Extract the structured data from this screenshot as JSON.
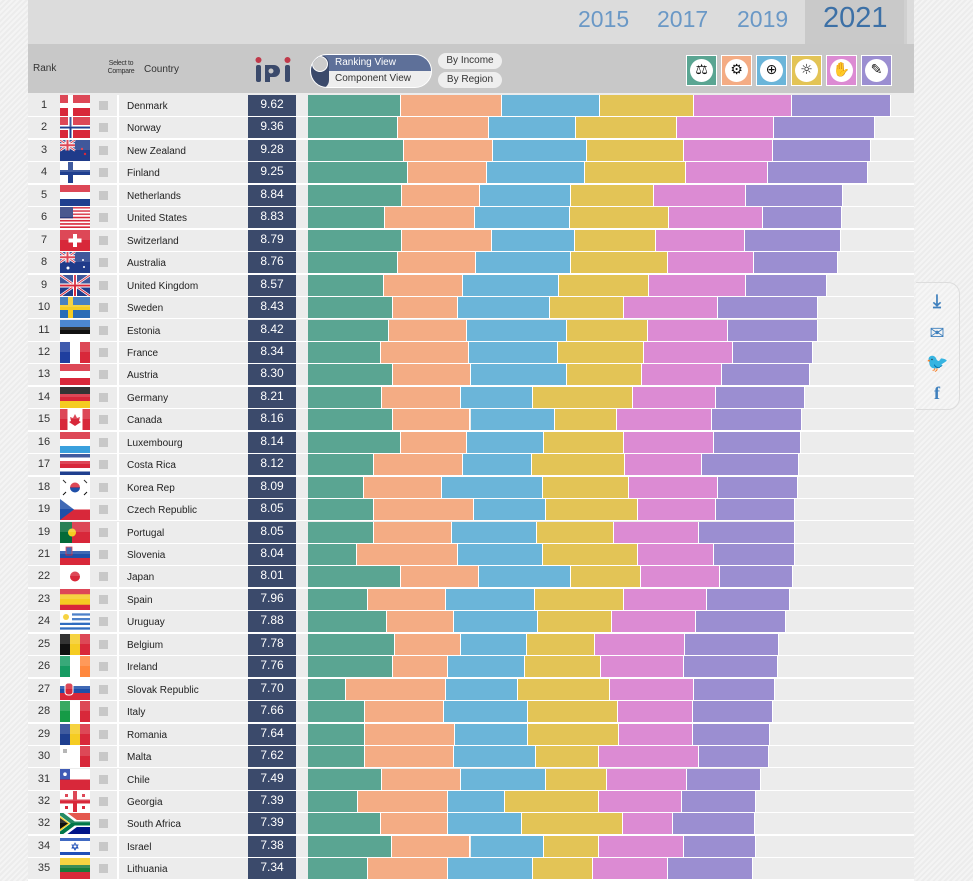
{
  "years": [
    "2015",
    "2017",
    "2019",
    "2021"
  ],
  "selected_year": "2021",
  "header": {
    "rank": "Rank",
    "select": "Select to Compare",
    "country": "Country",
    "logo": "iPi",
    "ranking_view": "Ranking View",
    "component_view": "Component View",
    "by_income": "By Income",
    "by_region": "By Region"
  },
  "component_icons": [
    {
      "icon": "gavel-icon",
      "color": "#5aa592"
    },
    {
      "icon": "document-gear-icon",
      "color": "#f4ac84"
    },
    {
      "icon": "globe-icon",
      "color": "#6bb5d9"
    },
    {
      "icon": "lightbulb-icon",
      "color": "#e3c456"
    },
    {
      "icon": "hand-icon",
      "color": "#dc8bd3"
    },
    {
      "icon": "pen-paper-icon",
      "color": "#9b8ed1"
    }
  ],
  "side_icons": [
    "download-icon",
    "email-icon",
    "twitter-icon",
    "facebook-icon"
  ],
  "chart_data": {
    "type": "bar",
    "stacked": true,
    "orientation": "horizontal",
    "series_colors": [
      "#5aa592",
      "#f4ac84",
      "#6bb5d9",
      "#e3c456",
      "#dc8bd3",
      "#9b8ed1"
    ],
    "rows": [
      {
        "rank": "1",
        "country": "Denmark",
        "score": "9.62",
        "components": [
          9.24,
          9.98,
          9.71,
          9.32,
          9.71,
          9.78
        ]
      },
      {
        "rank": "2",
        "country": "Norway",
        "score": "9.36",
        "components": [
          8.96,
          8.92,
          8.69,
          9.98,
          9.59,
          10.0
        ]
      },
      {
        "rank": "3",
        "country": "New Zealand",
        "score": "9.28",
        "components": [
          9.55,
          8.81,
          9.28,
          9.63,
          8.81,
          9.63
        ]
      },
      {
        "rank": "4",
        "country": "Finland",
        "score": "9.25",
        "components": [
          9.94,
          7.83,
          9.67,
          10.0,
          8.14,
          9.86
        ]
      },
      {
        "rank": "5",
        "country": "Netherlands",
        "score": "8.84",
        "components": [
          9.32,
          7.75,
          9.0,
          8.22,
          9.12,
          9.59
        ]
      },
      {
        "rank": "6",
        "country": "United States",
        "score": "8.83",
        "components": [
          7.63,
          8.92,
          9.43,
          9.78,
          9.32,
          7.83
        ]
      },
      {
        "rank": "7",
        "country": "Switzerland",
        "score": "8.79",
        "components": [
          9.32,
          8.85,
          8.3,
          8.02,
          8.73,
          9.51
        ]
      },
      {
        "rank": "8",
        "country": "Australia",
        "score": "8.76",
        "components": [
          8.96,
          7.71,
          9.39,
          9.63,
          8.49,
          8.34
        ]
      },
      {
        "rank": "9",
        "country": "United Kingdom",
        "score": "8.57",
        "components": [
          7.55,
          7.83,
          9.51,
          8.92,
          9.51,
          8.1
        ]
      },
      {
        "rank": "10",
        "country": "Sweden",
        "score": "8.43",
        "components": [
          8.38,
          6.5,
          9.04,
          7.4,
          9.32,
          9.9
        ]
      },
      {
        "rank": "11",
        "country": "Estonia",
        "score": "8.42",
        "components": [
          7.98,
          7.79,
          9.9,
          8.02,
          7.91,
          8.92
        ]
      },
      {
        "rank": "12",
        "country": "France",
        "score": "8.34",
        "components": [
          7.2,
          8.77,
          8.81,
          8.53,
          8.73,
          7.98
        ]
      },
      {
        "rank": "13",
        "country": "Austria",
        "score": "8.30",
        "components": [
          8.38,
          7.79,
          9.43,
          7.44,
          7.98,
          8.73
        ]
      },
      {
        "rank": "14",
        "country": "Germany",
        "score": "8.21",
        "components": [
          7.36,
          7.75,
          7.2,
          9.82,
          8.22,
          8.88
        ]
      },
      {
        "rank": "15",
        "country": "Canada",
        "score": "8.16",
        "components": [
          8.38,
          7.71,
          8.41,
          6.14,
          9.39,
          8.92
        ]
      },
      {
        "rank": "16",
        "country": "Luxembourg",
        "score": "8.14",
        "components": [
          9.16,
          6.54,
          7.63,
          7.98,
          8.92,
          8.61
        ]
      },
      {
        "rank": "17",
        "country": "Costa Rica",
        "score": "8.12",
        "components": [
          6.5,
          8.88,
          6.77,
          9.24,
          7.59,
          9.67
        ]
      },
      {
        "rank": "18",
        "country": "Korea Rep",
        "score": "8.09",
        "components": [
          5.56,
          7.75,
          10.0,
          8.49,
          8.81,
          7.91
        ]
      },
      {
        "rank": "19",
        "country": "Czech Republic",
        "score": "8.05",
        "components": [
          6.5,
          9.98,
          7.12,
          9.12,
          7.71,
          7.83
        ]
      },
      {
        "rank": "19",
        "country": "Portugal",
        "score": "8.05",
        "components": [
          6.58,
          7.71,
          8.34,
          7.63,
          8.41,
          9.59
        ]
      },
      {
        "rank": "21",
        "country": "Slovenia",
        "score": "8.04",
        "components": [
          4.89,
          10.0,
          8.41,
          9.39,
          7.55,
          7.98
        ]
      },
      {
        "rank": "22",
        "country": "Japan",
        "score": "8.01",
        "components": [
          9.24,
          7.71,
          9.12,
          6.93,
          7.83,
          7.24
        ]
      },
      {
        "rank": "23",
        "country": "Spain",
        "score": "7.96",
        "components": [
          5.99,
          7.71,
          8.81,
          8.73,
          8.22,
          8.3
        ]
      },
      {
        "rank": "24",
        "country": "Uruguay",
        "score": "7.88",
        "components": [
          7.87,
          6.61,
          8.34,
          7.28,
          8.34,
          8.85
        ]
      },
      {
        "rank": "25",
        "country": "Belgium",
        "score": "7.78",
        "components": [
          8.57,
          6.61,
          6.46,
          6.81,
          8.85,
          9.35
        ]
      },
      {
        "rank": "26",
        "country": "Ireland",
        "score": "7.76",
        "components": [
          8.38,
          5.52,
          7.63,
          7.44,
          8.22,
          9.39
        ]
      },
      {
        "rank": "27",
        "country": "Slovak Republic",
        "score": "7.70",
        "components": [
          3.72,
          9.98,
          7.05,
          9.2,
          8.3,
          7.95
        ]
      },
      {
        "rank": "28",
        "country": "Italy",
        "score": "7.66",
        "components": [
          5.68,
          7.83,
          8.26,
          8.88,
          7.44,
          7.91
        ]
      },
      {
        "rank": "29",
        "country": "Romania",
        "score": "7.64",
        "components": [
          5.68,
          8.92,
          7.16,
          9.04,
          7.36,
          7.63
        ]
      },
      {
        "rank": "30",
        "country": "Malta",
        "score": "7.62",
        "components": [
          5.68,
          8.81,
          8.1,
          6.18,
          9.98,
          6.93
        ]
      },
      {
        "rank": "31",
        "country": "Chile",
        "score": "7.49",
        "components": [
          7.36,
          7.75,
          8.41,
          6.11,
          7.91,
          7.36
        ]
      },
      {
        "rank": "32",
        "country": "Georgia",
        "score": "7.39",
        "components": [
          4.97,
          8.85,
          5.71,
          9.32,
          8.22,
          7.32
        ]
      },
      {
        "rank": "32",
        "country": "South Africa",
        "score": "7.39",
        "components": [
          7.24,
          6.65,
          7.32,
          10.0,
          4.93,
          8.14
        ]
      },
      {
        "rank": "34",
        "country": "Israel",
        "score": "7.38",
        "components": [
          8.34,
          7.75,
          7.32,
          5.36,
          8.49,
          7.05
        ]
      },
      {
        "rank": "35",
        "country": "Lithuania",
        "score": "7.34",
        "components": [
          5.99,
          7.83,
          8.41,
          5.95,
          7.51,
          8.41
        ]
      }
    ]
  }
}
